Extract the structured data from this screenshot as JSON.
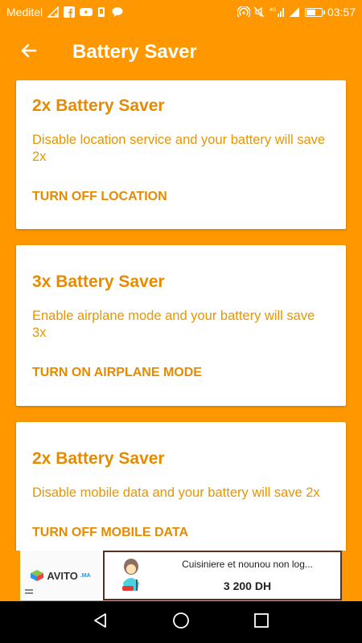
{
  "status_bar": {
    "carrier": "Meditel",
    "time": "03:57",
    "left_icons": [
      "signal-off-icon",
      "facebook-icon",
      "youtube-icon",
      "notification-icon",
      "chat-icon"
    ],
    "right_icons": [
      "hotspot-icon",
      "mute-icon",
      "network-4g-icon",
      "signal-icon",
      "battery-icon"
    ],
    "network_label": "4G"
  },
  "app_bar": {
    "back_icon": "arrow-left-icon",
    "title": "Battery Saver"
  },
  "cards": [
    {
      "title": "2x Battery Saver",
      "description": "Disable location service and your battery will save 2x",
      "action": "TURN OFF LOCATION"
    },
    {
      "title": "3x Battery Saver",
      "description": "Enable airplane mode and your battery will save 3x",
      "action": "TURN ON AIRPLANE MODE"
    },
    {
      "title": "2x Battery Saver",
      "description": "Disable mobile data and your battery will save 2x",
      "action": "TURN OFF MOBILE DATA"
    }
  ],
  "ad": {
    "brand": "AVITO",
    "brand_suffix": ".MA",
    "title": "Cuisiniere et nounou non log...",
    "price": "3 200 DH"
  },
  "nav_bar": {
    "icons": [
      "back-triangle-icon",
      "home-circle-icon",
      "recents-square-icon"
    ]
  },
  "colors": {
    "primary": "#FF9800",
    "accent_text": "#E68A00",
    "card_bg": "#FFFFFF",
    "nav_bg": "#000000"
  }
}
